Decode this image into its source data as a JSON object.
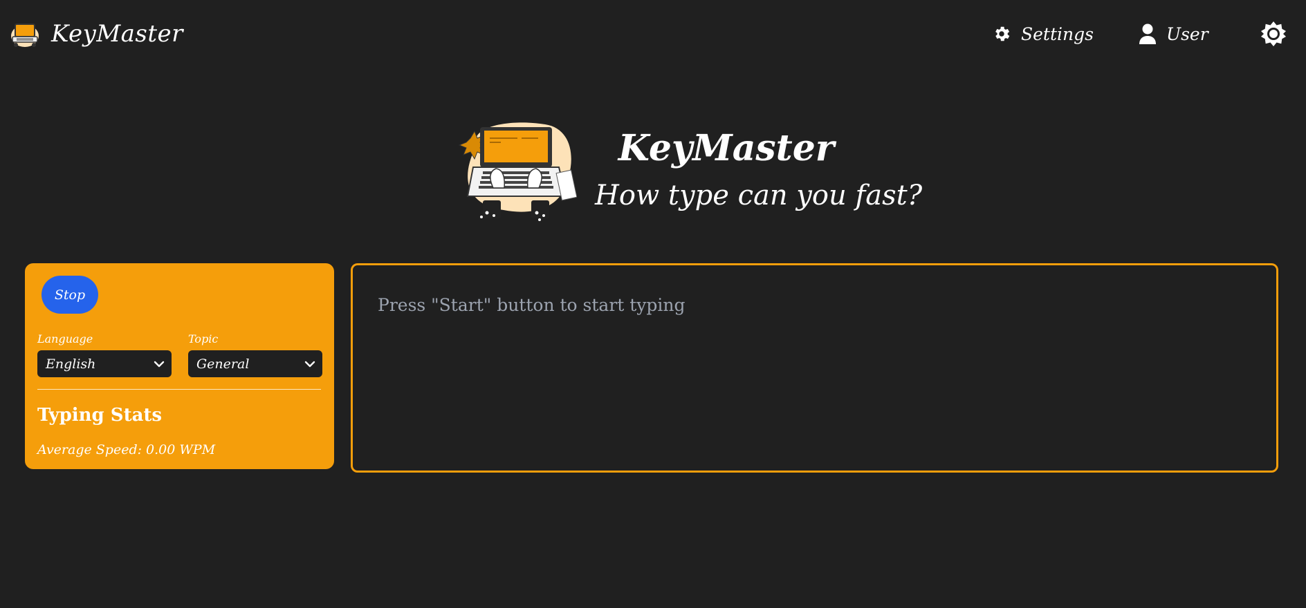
{
  "navbar": {
    "brand_name": "KeyMaster",
    "settings_label": "Settings",
    "user_label": "User",
    "icons": {
      "brand": "laptop-logo-icon",
      "settings": "gear-icon",
      "user": "user-icon",
      "theme": "sun-icon"
    }
  },
  "hero": {
    "title": "KeyMaster",
    "subtitle": "How type can you fast?",
    "illustration": "typing-laptop-illustration"
  },
  "controls": {
    "stop_label": "Stop",
    "language_label": "Language",
    "language_value": "English",
    "topic_label": "Topic",
    "topic_value": "General"
  },
  "stats": {
    "title": "Typing Stats",
    "average_speed": "Average Speed: 0.00 WPM"
  },
  "typing": {
    "prompt": "Press \"Start\" button to start typing"
  },
  "colors": {
    "background": "#202020",
    "accent": "#f59e0b",
    "button": "#2563eb",
    "prompt_text": "#9ca3af"
  }
}
